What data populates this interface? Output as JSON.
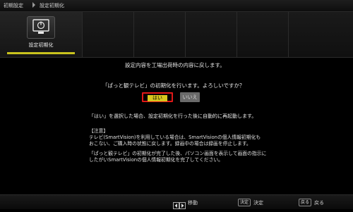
{
  "breadcrumb": {
    "parent": "初期設定",
    "current": "設定初期化"
  },
  "tabs": [
    {
      "label": "設定初期化",
      "icon": "power-icon",
      "active": true
    }
  ],
  "main": {
    "description": "設定内容を工場出荷時の内容に戻します。",
    "question": "「ぱっと観テレビ」の初期化を行います。よろしいですか？",
    "yes_label": "はい",
    "no_label": "いいえ",
    "after_note": "「はい」を選択した場合、設定初期化を行った後に自動的に再起動します。",
    "notice_heading": "【注意】",
    "notice_lines": [
      "テレビ(SmartVision)を利用している場合は、SmartVisionの個人情報初期化も",
      "おこない、ご購入時の状態に戻します。録画中の場合は録画を停止します。",
      "「ぱっと観テレビ」の初期化が完了した後、パソコン画面を表示して画面の指示に",
      "したがいSmartVisionの個人情報初期化を完了してください。"
    ]
  },
  "footer": {
    "move_label": "移動",
    "enter_key": "決定",
    "enter_label": "決定",
    "back_key": "戻る",
    "back_label": "戻る"
  },
  "colors": {
    "accent_yellow": "#d8c61e",
    "focus_red": "#e01818",
    "background": "#000000"
  }
}
